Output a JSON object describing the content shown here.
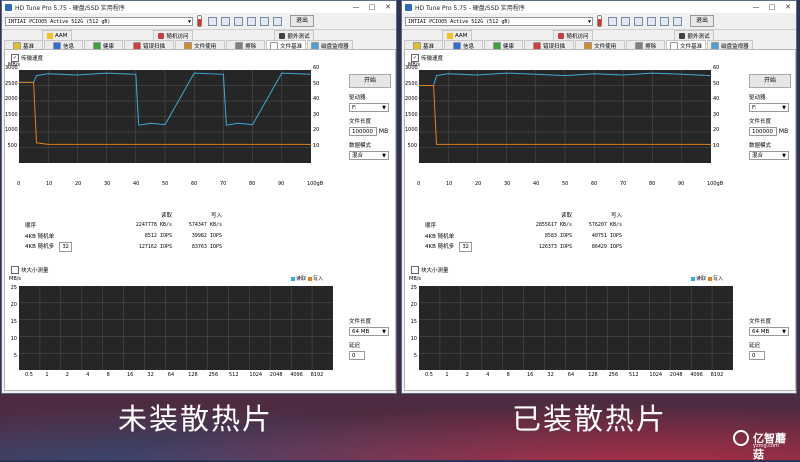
{
  "captions": {
    "left": "未装散热片",
    "right": "已装散热片"
  },
  "logo": {
    "text": "亿智蘑菇",
    "sub": "yzmg.com"
  },
  "windows": [
    {
      "title": "HD Tune Pro 5.75 - 硬盘/SSD 实用程序",
      "drive": "INTIAI PCIO05 Active 512G (512 gB)",
      "exit": "退出",
      "tabs_top": [
        "AAM",
        "随机访问",
        "额外测试"
      ],
      "tabs_bottom": [
        "基准",
        "信息",
        "健康",
        "错误扫描",
        "文件使用",
        "擦除",
        "文件基准",
        "磁盘监视器"
      ],
      "transfer_label": "传输速度",
      "start": "开始",
      "drive_label": "驱动器",
      "drive_value": "F:",
      "file_length_label": "文件长度",
      "file_length_value": "100000",
      "file_length_unit": "MB",
      "data_mode_label": "数据模式",
      "data_mode_value": "混合",
      "chart_axes": {
        "y_left_unit": "MB/s",
        "y_left_ticks": [
          "3000",
          "2500",
          "2000",
          "1500",
          "1000",
          "500"
        ],
        "y_right_ticks": [
          "60",
          "50",
          "40",
          "30",
          "20",
          "10"
        ],
        "x_ticks": [
          "0",
          "10",
          "20",
          "30",
          "40",
          "50",
          "60",
          "70",
          "80",
          "90",
          "100gB"
        ]
      },
      "results": {
        "read_header": "读取",
        "write_header": "写入",
        "rows": [
          {
            "label": "顺序",
            "read": "2247778 KB/s",
            "write": "574347 KB/s"
          },
          {
            "label": "4KB 随机单",
            "read": "8512 IOPS",
            "write": "39982 IOPS"
          },
          {
            "label": "4KB 随机多",
            "read": "127162 IOPS",
            "write": "83763 IOPS"
          }
        ],
        "queue_depth": "32"
      },
      "block_size_label": "块大小测量",
      "legend_read": "读取",
      "legend_write": "写入",
      "chart2_axes": {
        "y_unit": "MB/s",
        "y_ticks": [
          "25",
          "20",
          "15",
          "10",
          "5"
        ],
        "x_ticks": [
          "0.5",
          "1",
          "2",
          "4",
          "8",
          "16",
          "32",
          "64",
          "128",
          "256",
          "512",
          "1024",
          "2048",
          "4096",
          "8192"
        ]
      },
      "file_length2_label": "文件长度",
      "file_length2_value": "64 MB",
      "delay_label": "延迟",
      "delay_value": "0"
    },
    {
      "title": "HD Tune Pro 5.75 - 硬盘/SSD 实用程序",
      "drive": "INTIAI PCIO05 Active 512G (512 gB)",
      "exit": "退出",
      "tabs_top": [
        "AAM",
        "随机访问",
        "额外测试"
      ],
      "tabs_bottom": [
        "基准",
        "信息",
        "健康",
        "错误扫描",
        "文件使用",
        "擦除",
        "文件基准",
        "磁盘监视器"
      ],
      "transfer_label": "传输速度",
      "start": "开始",
      "drive_label": "驱动器",
      "drive_value": "F:",
      "file_length_label": "文件长度",
      "file_length_value": "100000",
      "file_length_unit": "MB",
      "data_mode_label": "数据模式",
      "data_mode_value": "混合",
      "chart_axes": {
        "y_left_unit": "MB/s",
        "y_left_ticks": [
          "3000",
          "2500",
          "2000",
          "1500",
          "1000",
          "500"
        ],
        "y_right_ticks": [
          "60",
          "50",
          "40",
          "30",
          "20",
          "10"
        ],
        "x_ticks": [
          "0",
          "10",
          "20",
          "30",
          "40",
          "50",
          "60",
          "70",
          "80",
          "90",
          "100gB"
        ]
      },
      "results": {
        "read_header": "读取",
        "write_header": "写入",
        "rows": [
          {
            "label": "顺序",
            "read": "2855617 KB/s",
            "write": "576207 KB/s"
          },
          {
            "label": "4KB 随机单",
            "read": "8583 IOPS",
            "write": "40751 IOPS"
          },
          {
            "label": "4KB 随机多",
            "read": "126373 IOPS",
            "write": "86429 IOPS"
          }
        ],
        "queue_depth": "32"
      },
      "block_size_label": "块大小测量",
      "legend_read": "读取",
      "legend_write": "写入",
      "chart2_axes": {
        "y_unit": "MB/s",
        "y_ticks": [
          "25",
          "20",
          "15",
          "10",
          "5"
        ],
        "x_ticks": [
          "0.5",
          "1",
          "2",
          "4",
          "8",
          "16",
          "32",
          "64",
          "128",
          "256",
          "512",
          "1024",
          "2048",
          "4096",
          "8192"
        ]
      },
      "file_length2_label": "文件长度",
      "file_length2_value": "64 MB",
      "delay_label": "延迟",
      "delay_value": "0"
    }
  ],
  "chart_data": [
    {
      "type": "line",
      "x": [
        0,
        5,
        6,
        10,
        20,
        30,
        40,
        41,
        45,
        50,
        60,
        70,
        71,
        75,
        80,
        90,
        100
      ],
      "series": [
        {
          "values": [
            2600,
            2600,
            2900,
            2900,
            2900,
            2900,
            2900,
            1300,
            1300,
            1300,
            2900,
            2900,
            1300,
            1300,
            1300,
            2900,
            2900
          ],
          "color": "#3fa9d6"
        },
        {
          "values": [
            2600,
            2600,
            650,
            600,
            600,
            600,
            600,
            600,
            600,
            600,
            600,
            600,
            600,
            600,
            600,
            600,
            600
          ],
          "color": "#e0801a"
        }
      ],
      "xlim": [
        0,
        100
      ],
      "ylim": [
        0,
        3000
      ],
      "grid": true
    },
    {
      "type": "line",
      "x": [
        0,
        5,
        6,
        10,
        20,
        30,
        40,
        50,
        60,
        70,
        80,
        90,
        100
      ],
      "series": [
        {
          "values": [
            2500,
            2500,
            2900,
            2900,
            2900,
            2900,
            2900,
            2900,
            2900,
            2900,
            2900,
            2900,
            2900
          ],
          "color": "#3fa9d6"
        },
        {
          "values": [
            2500,
            2500,
            600,
            600,
            600,
            600,
            600,
            600,
            600,
            600,
            600,
            600,
            600
          ],
          "color": "#e0801a"
        }
      ],
      "xlim": [
        0,
        100
      ],
      "ylim": [
        0,
        3000
      ],
      "grid": true
    }
  ]
}
